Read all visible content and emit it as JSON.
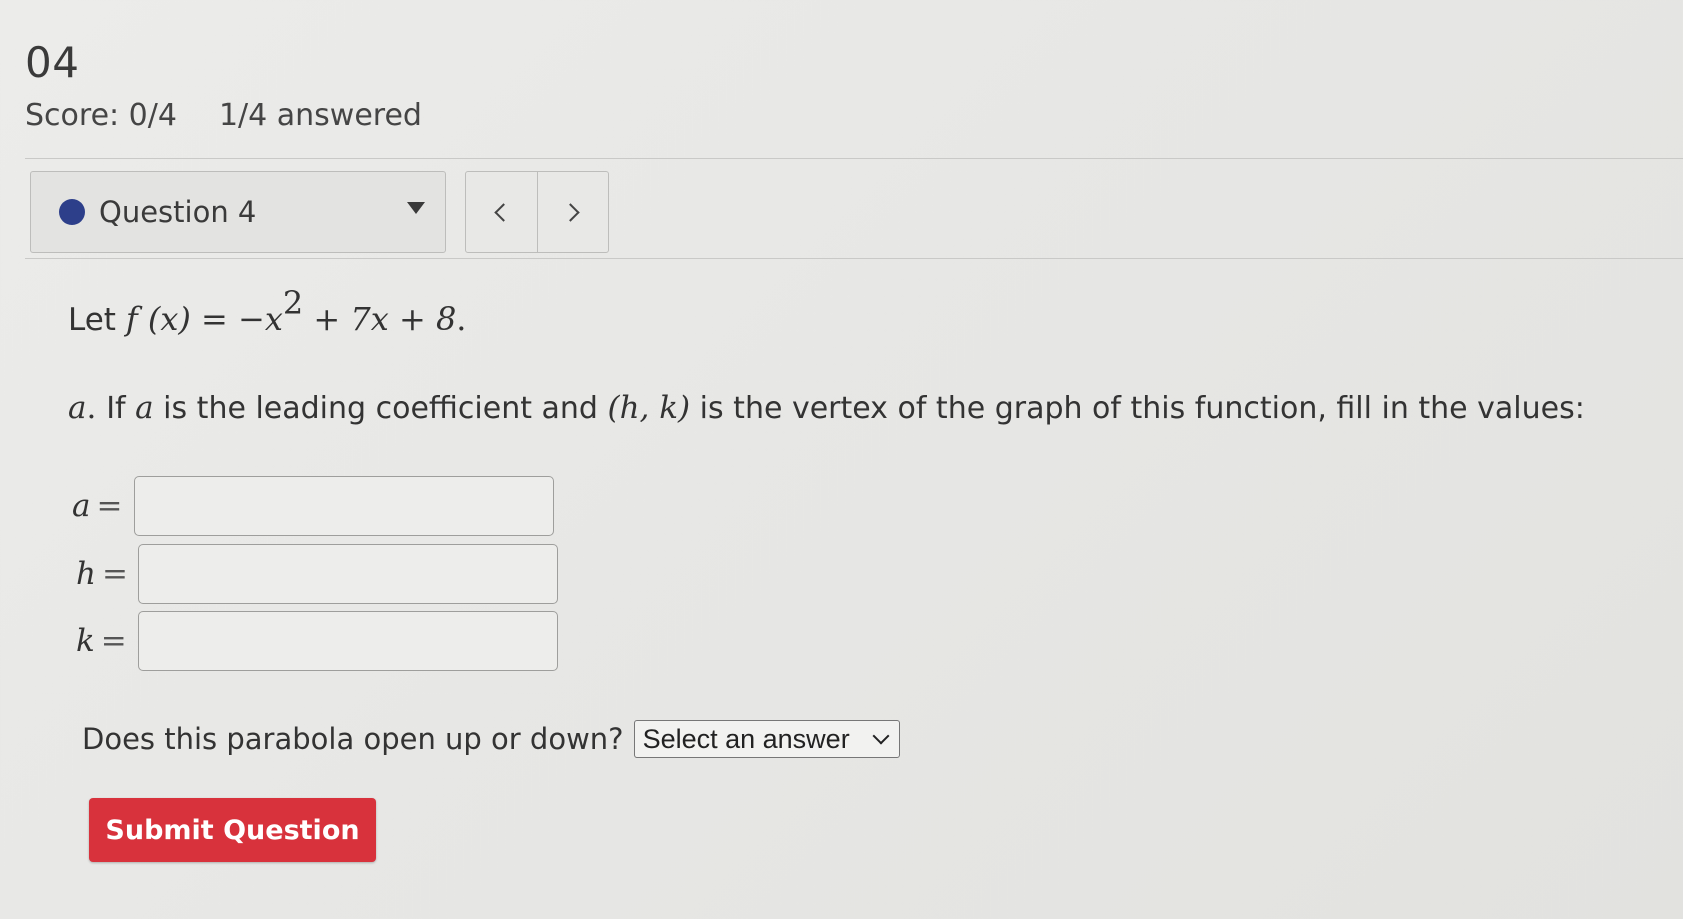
{
  "header": {
    "assignment_title": "04",
    "score_text": "Score: 0/4",
    "answered_text": "1/4 answered"
  },
  "question_nav": {
    "selected_label": "Question 4",
    "status_color": "#2d3f8a",
    "icons": {
      "status": "status-dot-icon",
      "dropdown": "caret-down-icon",
      "prev": "chevron-left-icon",
      "next": "chevron-right-icon"
    }
  },
  "question": {
    "stem": {
      "prefix": "Let ",
      "func": "f",
      "arg": " (x) = −x",
      "exp": "2",
      "rest": " + 7x + 8",
      "suffix": "."
    },
    "part_a": {
      "label_var": "a",
      "label_punct": ". ",
      "text1": "If ",
      "var_a": "a",
      "text2": " is the leading coefficient and ",
      "pair": "(h, k)",
      "text3": " is the vertex of the graph of this function, fill in the values:"
    },
    "fields": [
      {
        "var": "a",
        "eq": "=",
        "value": ""
      },
      {
        "var": "h",
        "eq": "=",
        "value": ""
      },
      {
        "var": "k",
        "eq": "=",
        "value": ""
      }
    ],
    "direction": {
      "question": "Does this parabola open up or down?",
      "selected": "Select an answer"
    }
  },
  "actions": {
    "submit_label": "Submit Question",
    "submit_color": "#d8323c"
  }
}
